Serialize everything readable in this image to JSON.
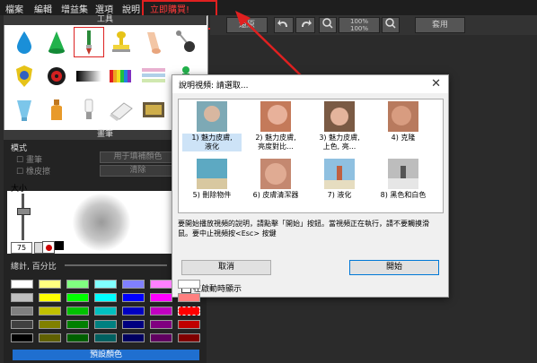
{
  "menu": {
    "items": [
      "檔案",
      "編輯",
      "增益集",
      "選項",
      "說明"
    ],
    "promo": "立即購買!"
  },
  "toolbar": {
    "restore_label": "還原",
    "zoom_top": "100%",
    "zoom_bottom": "100%",
    "apply_label": "套用"
  },
  "tools_panel": {
    "title": "工具",
    "tools": [
      "drop-icon",
      "cone-icon",
      "brush-icon",
      "stamp-icon",
      "finger-icon",
      "pin-icon",
      "badge-icon",
      "eye-icon",
      "gradient-icon",
      "color-bars-icon",
      "texture-icon",
      "figure-icon",
      "cup-icon",
      "bottle-icon",
      "bulb-icon",
      "eraser-icon",
      "tv-icon"
    ]
  },
  "brush_panel": {
    "title": "畫筆",
    "mode_label": "模式",
    "paint_option": "畫筆",
    "eraser_option": "橡皮擦",
    "fill_all_button": "用于填補顏色",
    "clear_button": "清除",
    "size_label": "大小",
    "size_value": "75",
    "opacity_label": "總計, 百分比",
    "preset_button": "預設顏色",
    "brush_size": 0.75,
    "swatches": [
      [
        "#ffffff",
        "#ffff80",
        "#80ff80",
        "#80ffff",
        "#8080ff",
        "#ff80ff",
        "#ffffff"
      ],
      [
        "#c0c0c0",
        "#ffff00",
        "#00ff00",
        "#00ffff",
        "#0000ff",
        "#ff00ff",
        "#ff8080"
      ],
      [
        "#808080",
        "#c0c000",
        "#00c000",
        "#00c0c0",
        "#0000c0",
        "#c000c0",
        "#ff0000"
      ],
      [
        "#404040",
        "#808000",
        "#008000",
        "#008080",
        "#000080",
        "#800080",
        "#c00000"
      ],
      [
        "#000000",
        "#606000",
        "#006000",
        "#006060",
        "#000060",
        "#600060",
        "#800000"
      ]
    ]
  },
  "dialog": {
    "title": "說明視頻: 請選取...",
    "videos": [
      {
        "label": "1) 魅力皮膚,\n液化"
      },
      {
        "label": "2) 魅力皮膚,\n亮度對比..."
      },
      {
        "label": "3) 魅力皮膚,\n上色, 亮..."
      },
      {
        "label": "4) 克隆"
      },
      {
        "label": "5) 刪除物件"
      },
      {
        "label": "6) 皮膚清潔器"
      },
      {
        "label": "7) 液化"
      },
      {
        "label": "8) 黑色和白色"
      }
    ],
    "description": "要開始播放視頻的說明，請點擊「開始」按鈕。當視頻正在執行，請不要觸摸滑鼠。要中止視頻按<Esc> 按鍵",
    "cancel_button": "取消",
    "start_button": "開始",
    "checkbox_label": "在啟動時顯示"
  }
}
